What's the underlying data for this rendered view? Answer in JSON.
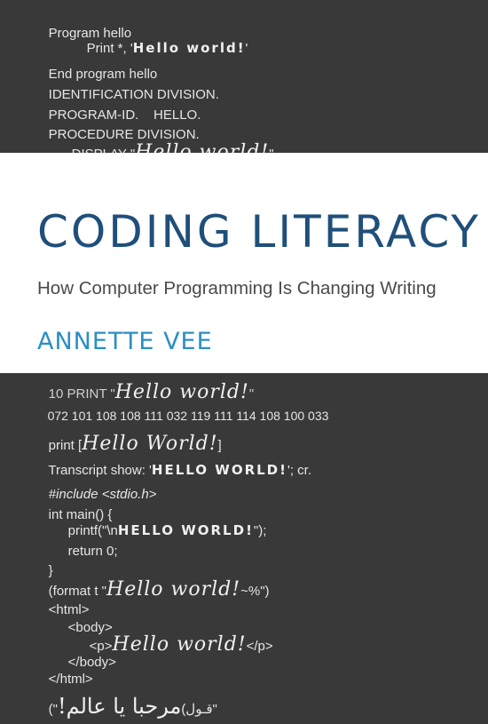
{
  "top_code": [
    {
      "text": "Program hello",
      "hand": ""
    },
    {
      "text": "Print *, '",
      "hand": "Hello world!",
      "tail": "'"
    },
    {
      "text": "End program hello",
      "hand": ""
    },
    {
      "text": "IDENTIFICATION DIVISION.",
      "hand": ""
    },
    {
      "text": "PROGRAM-ID.    HELLO.",
      "hand": ""
    },
    {
      "text": "PROCEDURE DIVISION.",
      "hand": ""
    },
    {
      "text": "DISPLAY \"",
      "hand": "Hello world!",
      "tail": "\""
    }
  ],
  "book": {
    "title": "CODING LITERACY",
    "subtitle": "How Computer Programming Is Changing Writing",
    "author": "ANNETTE VEE"
  },
  "bottom_code": [
    {
      "text": "10 PRINT \"",
      "hand": "Hello world!",
      "tail": "\""
    },
    {
      "text": "072 101 108 108 111 032 119 111 114 108 100 033",
      "hand": ""
    },
    {
      "text": "print [",
      "hand": "Hello World!",
      "tail": "]"
    },
    {
      "text": "Transcript show: '",
      "hand": "HELLO WORLD!",
      "tail": "'; cr."
    },
    {
      "text": "#include <stdio.h>",
      "hand": ""
    },
    {
      "text": "int main() {",
      "hand": ""
    },
    {
      "text": "printf(\"\\n",
      "hand": "HELLO WORLD!",
      "tail": "\");"
    },
    {
      "text": "return 0;",
      "hand": ""
    },
    {
      "text": "}",
      "hand": ""
    },
    {
      "text": "(format t \"",
      "hand": "Hello world!",
      "tail": "~%\")"
    },
    {
      "text": "<html>",
      "hand": ""
    },
    {
      "text": "<body>",
      "hand": ""
    },
    {
      "text": "<p>",
      "hand": "Hello world!",
      "tail": "</p>"
    },
    {
      "text": "</body>",
      "hand": ""
    },
    {
      "text": "</html>",
      "hand": ""
    },
    {
      "text": "(\"",
      "hand": "مرحبا يا عالم!",
      "tail": "\"قـول)"
    }
  ],
  "colors": {
    "background": "#393939",
    "band": "#ffffff",
    "title": "#1f4f7a",
    "subtitle": "#4a4a4a",
    "author": "#2a8fc4",
    "code": "#e6e6e6"
  }
}
